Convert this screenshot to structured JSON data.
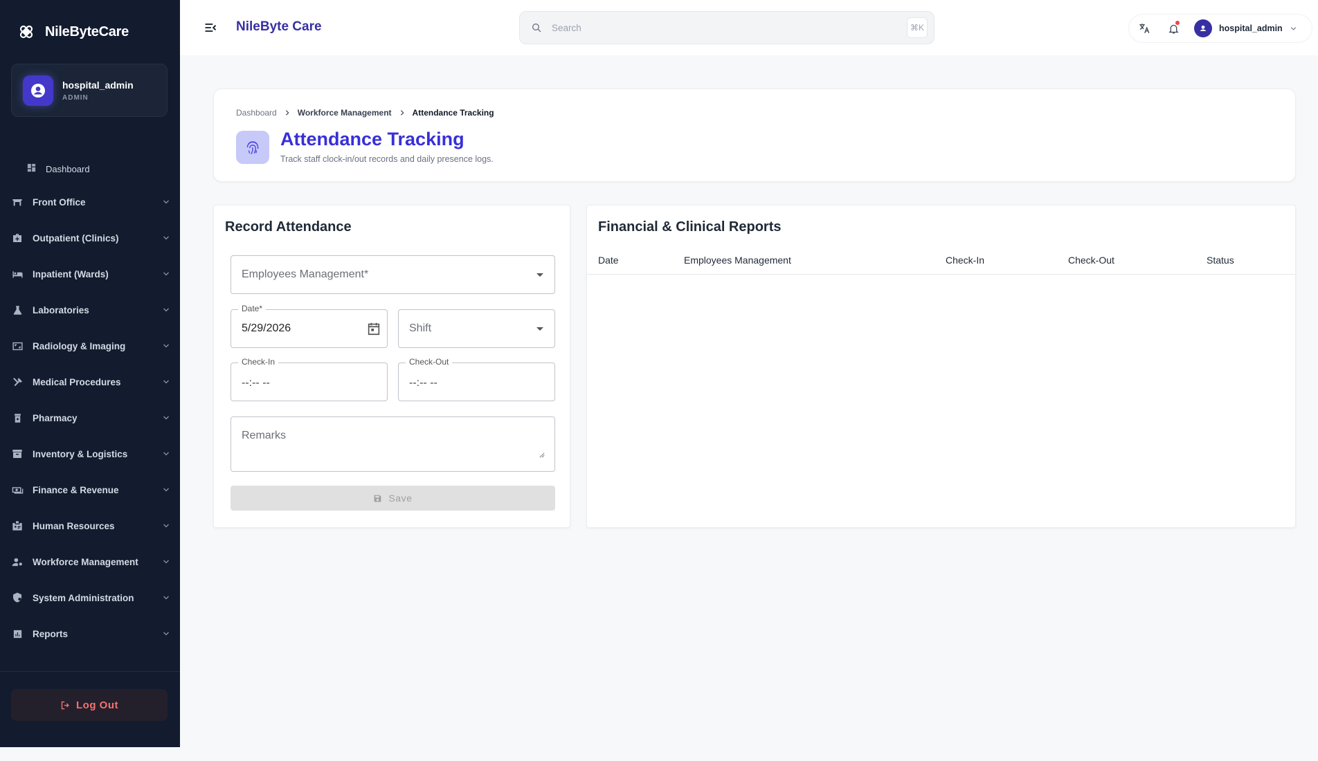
{
  "app": {
    "name": "NileByteCare",
    "header_title": "NileByte Care"
  },
  "user": {
    "name": "hospital_admin",
    "role": "ADMIN"
  },
  "sidebar": {
    "dashboard": "Dashboard",
    "items": [
      {
        "label": "Front Office",
        "icon": "front-office-icon"
      },
      {
        "label": "Outpatient (Clinics)",
        "icon": "briefcase-medical-icon"
      },
      {
        "label": "Inpatient (Wards)",
        "icon": "bed-icon"
      },
      {
        "label": "Laboratories",
        "icon": "flask-icon"
      },
      {
        "label": "Radiology & Imaging",
        "icon": "scan-icon"
      },
      {
        "label": "Medical Procedures",
        "icon": "tools-icon"
      },
      {
        "label": "Pharmacy",
        "icon": "pill-bottle-icon"
      },
      {
        "label": "Inventory & Logistics",
        "icon": "inventory-icon"
      },
      {
        "label": "Finance & Revenue",
        "icon": "payments-icon"
      },
      {
        "label": "Human Resources",
        "icon": "badge-icon"
      },
      {
        "label": "Workforce Management",
        "icon": "people-gear-icon"
      },
      {
        "label": "System Administration",
        "icon": "shield-gear-icon"
      },
      {
        "label": "Reports",
        "icon": "report-chart-icon"
      }
    ],
    "logout": "Log Out"
  },
  "header": {
    "search_placeholder": "Search",
    "shortcut": "⌘K",
    "username": "hospital_admin"
  },
  "page": {
    "breadcrumb": [
      "Dashboard",
      "Workforce Management",
      "Attendance Tracking"
    ],
    "title": "Attendance Tracking",
    "subtitle": "Track staff clock-in/out records and daily presence logs."
  },
  "form": {
    "title": "Record Attendance",
    "employee_placeholder": "Employees Management*",
    "date_label": "Date*",
    "date_value": "5/29/2026",
    "shift_placeholder": "Shift",
    "checkin_label": "Check-In",
    "checkin_value": "--:-- --",
    "checkout_label": "Check-Out",
    "checkout_value": "--:-- --",
    "remarks_placeholder": "Remarks",
    "save_label": "Save"
  },
  "reports": {
    "title": "Financial & Clinical Reports",
    "columns": [
      "Date",
      "Employees Management",
      "Check-In",
      "Check-Out",
      "Status"
    ],
    "rows": []
  },
  "colors": {
    "sidebar_bg": "#121c2e",
    "accent": "#3730d8",
    "logout_text": "#f87171",
    "notification_dot": "#ef4444"
  }
}
